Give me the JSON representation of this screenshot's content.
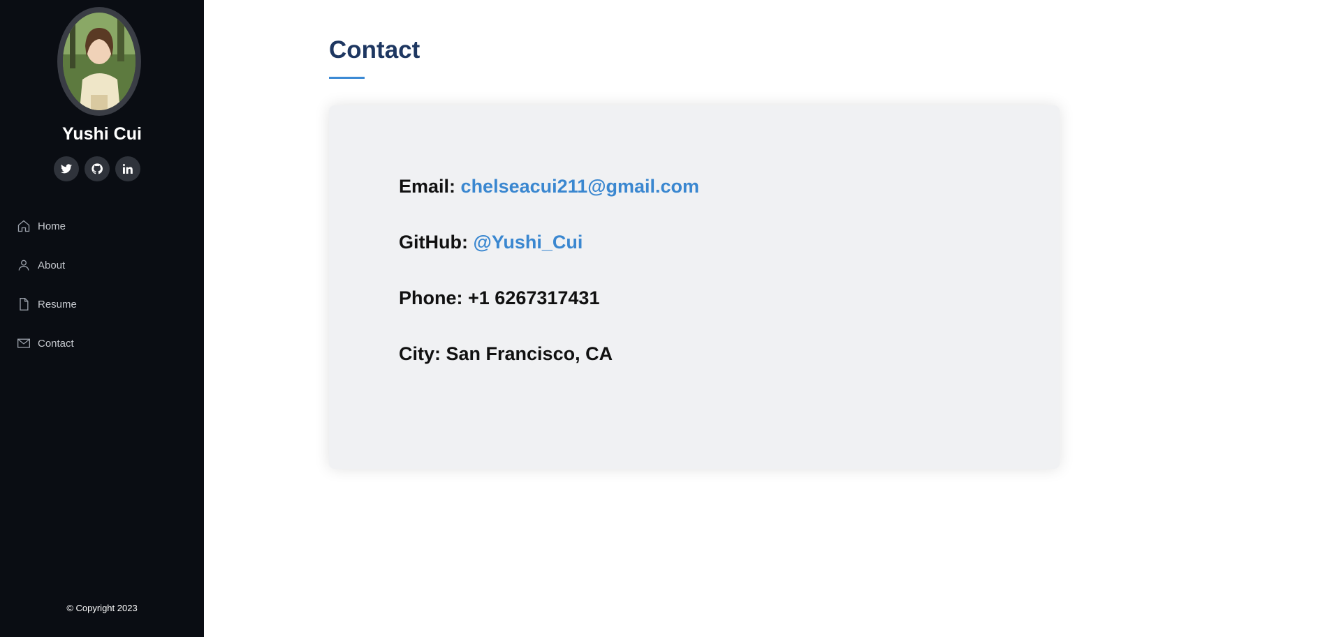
{
  "profile": {
    "name": "Yushi Cui",
    "avatar_alt": "profile photo",
    "socials": [
      {
        "icon": "twitter-icon",
        "glyph": "🐦"
      },
      {
        "icon": "github-icon",
        "glyph": "⌘"
      },
      {
        "icon": "linkedin-icon",
        "glyph": "in"
      }
    ]
  },
  "nav": {
    "items": [
      {
        "label": "Home",
        "icon": "home-icon"
      },
      {
        "label": "About",
        "icon": "person-icon"
      },
      {
        "label": "Resume",
        "icon": "file-icon"
      },
      {
        "label": "Contact",
        "icon": "envelope-icon"
      }
    ]
  },
  "footer": {
    "copyright": "© Copyright 2023"
  },
  "section": {
    "title": "Contact"
  },
  "contact": {
    "email_label": "Email:",
    "email_value": "chelseacui211@gmail.com",
    "github_label": "GitHub:",
    "github_value": "@Yushi_Cui",
    "phone_label": "Phone:",
    "phone_value": "+1 6267317431",
    "city_label": "City:",
    "city_value": "San Francisco, CA"
  },
  "colors": {
    "sidebar_bg": "#0a0d13",
    "title": "#1e3761",
    "accent": "#3c8ad4",
    "card_bg": "#f0f1f3"
  }
}
